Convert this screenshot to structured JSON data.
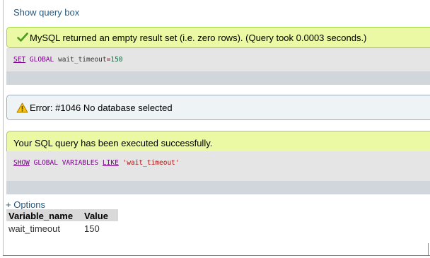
{
  "query_box": {
    "show_label": "Show query box"
  },
  "success_message": {
    "text": "MySQL returned an empty result set (i.e. zero rows). (Query took 0.0003 seconds.)"
  },
  "query1": {
    "kw_set": "SET",
    "kw_global": "GLOBAL",
    "variable": "wait_timeout",
    "op": "=",
    "value": "150"
  },
  "error_message": {
    "text": "Error: #1046 No database selected"
  },
  "executed_message": {
    "text": "Your SQL query has been executed successfully."
  },
  "query2": {
    "kw_show": "SHOW",
    "kw_global": "GLOBAL",
    "kw_variables": "VARIABLES",
    "kw_like": "LIKE",
    "pattern": "'wait_timeout'"
  },
  "options": {
    "label": "+ Options"
  },
  "results": {
    "headers": [
      "Variable_name",
      "Value"
    ],
    "rows": [
      [
        "wait_timeout",
        "150"
      ]
    ]
  },
  "icons": {
    "success": "check-icon",
    "error": "warning-icon"
  },
  "colors": {
    "link": "#235a81",
    "success_bg": "#ebf8a4",
    "success_border": "#a2d246",
    "error_bg": "#eef3f6",
    "sql_bg": "#e5e5e5",
    "keyword": "#770088"
  }
}
